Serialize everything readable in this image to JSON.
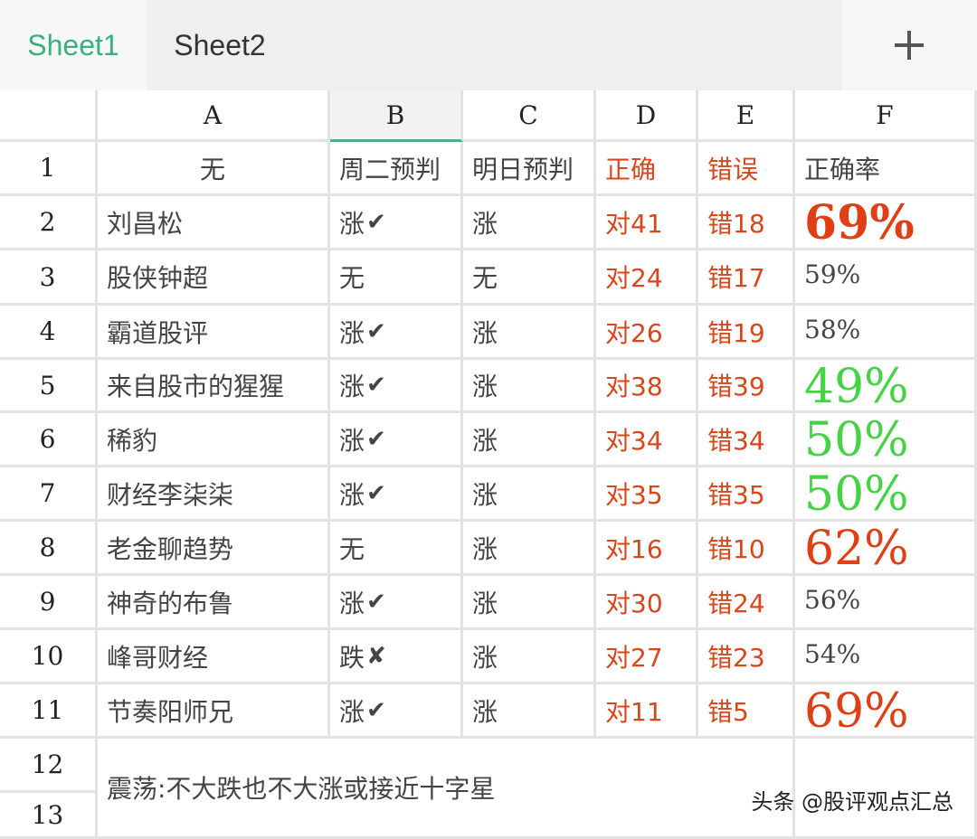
{
  "tabs": [
    {
      "label": "Sheet1",
      "active": true
    },
    {
      "label": "Sheet2",
      "active": false
    }
  ],
  "add_sheet_icon": "plus-icon",
  "columns": [
    "A",
    "B",
    "C",
    "D",
    "E",
    "F"
  ],
  "selected_column": "B",
  "row_numbers": [
    "1",
    "2",
    "3",
    "4",
    "5",
    "6",
    "7",
    "8",
    "9",
    "10",
    "11",
    "12",
    "13"
  ],
  "header_row": {
    "a": "无",
    "b": "周二预判",
    "c": "明日预判",
    "d": "正确",
    "e": "错误",
    "f": "正确率"
  },
  "rows": [
    {
      "name": "刘昌松",
      "tuesday": "涨",
      "tuesday_mark": "✔",
      "tomorrow": "涨",
      "correct": "对41",
      "wrong": "错18",
      "rate": "69%",
      "rate_style": "red-bold"
    },
    {
      "name": "股侠钟超",
      "tuesday": "无",
      "tuesday_mark": "",
      "tomorrow": "无",
      "correct": "对24",
      "wrong": "错17",
      "rate": "59%",
      "rate_style": "plain"
    },
    {
      "name": "霸道股评",
      "tuesday": "涨",
      "tuesday_mark": "✔",
      "tomorrow": "涨",
      "correct": "对26",
      "wrong": "错19",
      "rate": "58%",
      "rate_style": "plain"
    },
    {
      "name": "来自股市的猩猩",
      "tuesday": "涨",
      "tuesday_mark": "✔",
      "tomorrow": "涨",
      "correct": "对38",
      "wrong": "错39",
      "rate": "49%",
      "rate_style": "green"
    },
    {
      "name": "稀豹",
      "tuesday": "涨",
      "tuesday_mark": "✔",
      "tomorrow": "涨",
      "correct": "对34",
      "wrong": "错34",
      "rate": "50%",
      "rate_style": "green"
    },
    {
      "name": "财经李柒柒",
      "tuesday": "涨",
      "tuesday_mark": "✔",
      "tomorrow": "涨",
      "correct": "对35",
      "wrong": "错35",
      "rate": "50%",
      "rate_style": "green"
    },
    {
      "name": "老金聊趋势",
      "tuesday": "无",
      "tuesday_mark": "",
      "tomorrow": "涨",
      "correct": "对16",
      "wrong": "错10",
      "rate": "62%",
      "rate_style": "red"
    },
    {
      "name": "神奇的布鲁",
      "tuesday": "涨",
      "tuesday_mark": "✔",
      "tomorrow": "涨",
      "correct": "对30",
      "wrong": "错24",
      "rate": "56%",
      "rate_style": "plain"
    },
    {
      "name": "峰哥财经",
      "tuesday": "跌",
      "tuesday_mark": "✘",
      "tomorrow": "涨",
      "correct": "对27",
      "wrong": "错23",
      "rate": "54%",
      "rate_style": "plain"
    },
    {
      "name": "节奏阳师兄",
      "tuesday": "涨",
      "tuesday_mark": "✔",
      "tomorrow": "涨",
      "correct": "对11",
      "wrong": "错5",
      "rate": "69%",
      "rate_style": "red"
    }
  ],
  "note": "震荡:不大跌也不大涨或接近十字星",
  "watermark": "头条 @股评观点汇总",
  "colors": {
    "active_tab": "#3bb07f",
    "red": "#d9461b",
    "green": "#45d345",
    "text": "#444444"
  }
}
